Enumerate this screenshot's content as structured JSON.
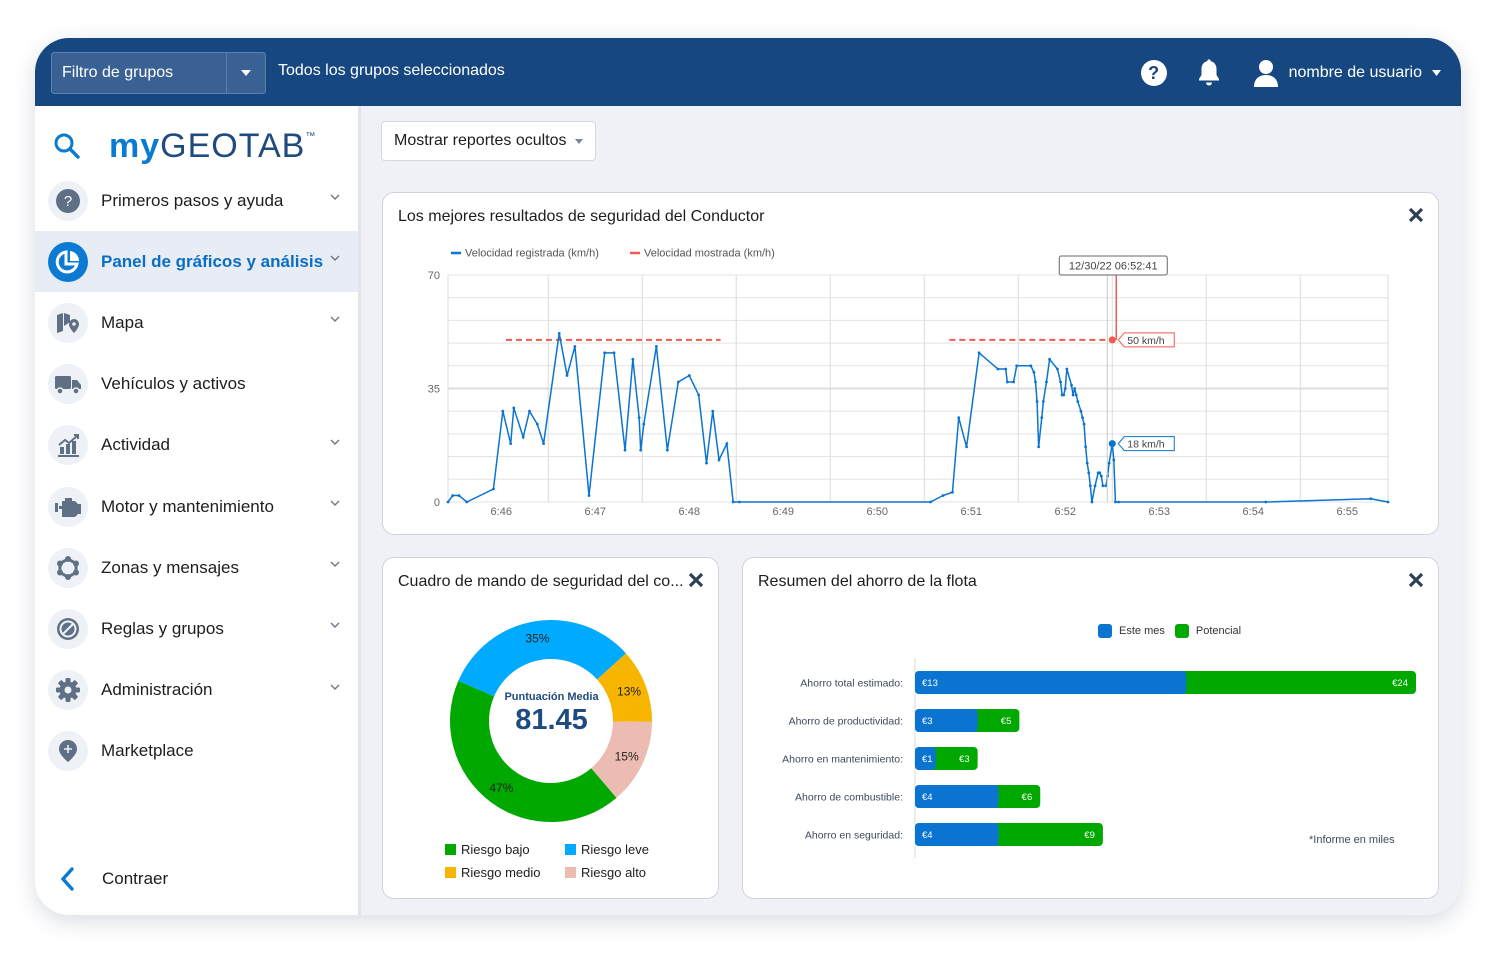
{
  "topbar": {
    "group_filter_label": "Filtro de grupos",
    "group_filter_status": "Todos los grupos seleccionados",
    "help_icon": "help-circle-icon",
    "notifications_icon": "bell-icon",
    "user_name": "nombre de usuario"
  },
  "sidebar": {
    "logo_my": "my",
    "logo_geotab": "GEOTAB",
    "logo_tm": "™",
    "items": [
      {
        "label": "Primeros pasos y ayuda",
        "icon": "help-icon",
        "expandable": true,
        "active": false
      },
      {
        "label": "Panel de gráficos y análisis",
        "icon": "pie-chart-icon",
        "expandable": true,
        "active": true
      },
      {
        "label": "Mapa",
        "icon": "map-icon",
        "expandable": true,
        "active": false
      },
      {
        "label": "Vehículos y activos",
        "icon": "truck-icon",
        "expandable": false,
        "active": false
      },
      {
        "label": "Actividad",
        "icon": "activity-chart-icon",
        "expandable": true,
        "active": false
      },
      {
        "label": "Motor y mantenimiento",
        "icon": "engine-icon",
        "expandable": true,
        "active": false
      },
      {
        "label": "Zonas y mensajes",
        "icon": "zones-icon",
        "expandable": true,
        "active": false
      },
      {
        "label": "Reglas y grupos",
        "icon": "rules-icon",
        "expandable": true,
        "active": false
      },
      {
        "label": "Administración",
        "icon": "gear-icon",
        "expandable": true,
        "active": false
      },
      {
        "label": "Marketplace",
        "icon": "marketplace-icon",
        "expandable": false,
        "active": false
      }
    ],
    "collapse_label": "Contraer"
  },
  "main": {
    "show_hidden_reports_label": "Mostrar reportes ocultos"
  },
  "colors": {
    "brand_navy": "#164780",
    "accent_blue": "#0a7ad3",
    "series_recorded": "#0b74d0",
    "series_displayed": "#f05a4f",
    "risk_low": "#00a800",
    "risk_slight": "#00aaff",
    "risk_medium": "#f8b500",
    "risk_high": "#ecbcb2",
    "bar_this_month": "#0b74d0",
    "bar_potential": "#00a800"
  },
  "chart_data": [
    {
      "type": "line",
      "title": "Los mejores resultados de seguridad del Conductor",
      "xlabel": "",
      "ylabel": "",
      "x_unit": "seconds after 6:45:00",
      "xlim": [
        26,
        626
      ],
      "ylim": [
        0,
        70
      ],
      "y_ticks": [
        0,
        35,
        70
      ],
      "y_grid_step": 7,
      "x_ticks": [
        {
          "t": 60,
          "label": "6:46"
        },
        {
          "t": 120,
          "label": "6:47"
        },
        {
          "t": 180,
          "label": "6:48"
        },
        {
          "t": 240,
          "label": "6:49"
        },
        {
          "t": 300,
          "label": "6:50"
        },
        {
          "t": 360,
          "label": "6:51"
        },
        {
          "t": 420,
          "label": "6:52"
        },
        {
          "t": 480,
          "label": "6:53"
        },
        {
          "t": 540,
          "label": "6:54"
        },
        {
          "t": 600,
          "label": "6:55"
        }
      ],
      "grid": true,
      "legend_position": "top-left",
      "series": [
        {
          "name": "Velocidad registrada (km/h)",
          "style": "solid",
          "points": [
            [
              26,
              0
            ],
            [
              29,
              2
            ],
            [
              33,
              2
            ],
            [
              38,
              0
            ],
            [
              55,
              4
            ],
            [
              61,
              28
            ],
            [
              66,
              18
            ],
            [
              68,
              29
            ],
            [
              74,
              20
            ],
            [
              78,
              28
            ],
            [
              83,
              24
            ],
            [
              87,
              18
            ],
            [
              97,
              52
            ],
            [
              102,
              39
            ],
            [
              107,
              48
            ],
            [
              116,
              2
            ],
            [
              126,
              46
            ],
            [
              132,
              46
            ],
            [
              139,
              16
            ],
            [
              144,
              44
            ],
            [
              148,
              26
            ],
            [
              149,
              16
            ],
            [
              151,
              24
            ],
            [
              159,
              48
            ],
            [
              166,
              16
            ],
            [
              173,
              37
            ],
            [
              180,
              39
            ],
            [
              186,
              33
            ],
            [
              191,
              12
            ],
            [
              195,
              28
            ],
            [
              199,
              13
            ],
            [
              204,
              18
            ],
            [
              208,
              0
            ],
            [
              212,
              0
            ],
            [
              334,
              0
            ],
            [
              342,
              2
            ],
            [
              348,
              3
            ],
            [
              352,
              26
            ],
            [
              357,
              17
            ],
            [
              365,
              46
            ],
            [
              377,
              41
            ],
            [
              382,
              41
            ],
            [
              383,
              37
            ],
            [
              387,
              37
            ],
            [
              389,
              42
            ],
            [
              398,
              42
            ],
            [
              400,
              40
            ],
            [
              401,
              37
            ],
            [
              402,
              31
            ],
            [
              403,
              17
            ],
            [
              405,
              26
            ],
            [
              406,
              31
            ],
            [
              408,
              37
            ],
            [
              410,
              44
            ],
            [
              415,
              41
            ],
            [
              417,
              37
            ],
            [
              418,
              33
            ],
            [
              419,
              33
            ],
            [
              420,
              35
            ],
            [
              421,
              41
            ],
            [
              424,
              36
            ],
            [
              425,
              33
            ],
            [
              426,
              35
            ],
            [
              427,
              33
            ],
            [
              428,
              31
            ],
            [
              430,
              28
            ],
            [
              431,
              26
            ],
            [
              432,
              24
            ],
            [
              433,
              17
            ],
            [
              434,
              12
            ],
            [
              435,
              9
            ],
            [
              436,
              5
            ],
            [
              437,
              0
            ],
            [
              439,
              5
            ],
            [
              441,
              9
            ],
            [
              442,
              9
            ],
            [
              443,
              8
            ],
            [
              444,
              5
            ],
            [
              446,
              5
            ],
            [
              447,
              8
            ],
            [
              448,
              12
            ],
            [
              450,
              18
            ],
            [
              451,
              13
            ],
            [
              452,
              0
            ],
            [
              454,
              0
            ],
            [
              548,
              0
            ],
            [
              615,
              1
            ],
            [
              626,
              0
            ]
          ]
        },
        {
          "name": "Velocidad mostrada (km/h)",
          "style": "dashed",
          "segments": [
            [
              [
                63,
                50
              ],
              [
                200,
                50
              ]
            ],
            [
              [
                346,
                50
              ],
              [
                450,
                50
              ]
            ]
          ]
        }
      ],
      "tooltip": {
        "timestamp": "12/30/22  06:52:41",
        "t": 450,
        "displayed_label": "50 km/h",
        "displayed_value": 50,
        "recorded_label": "18 km/h",
        "recorded_value": 18
      }
    },
    {
      "type": "pie",
      "title": "Cuadro de mando de seguridad del co...",
      "center_label": "Puntuación Media",
      "center_value": "81.45",
      "legend_position": "bottom",
      "slices": [
        {
          "name": "Riesgo leve",
          "value": 35,
          "label": "35%"
        },
        {
          "name": "Riesgo medio",
          "value": 13,
          "label": "13%"
        },
        {
          "name": "Riesgo alto",
          "value": 15,
          "label": "15%"
        },
        {
          "name": "Riesgo bajo",
          "value": 47,
          "label": "47%"
        }
      ],
      "legend": [
        "Riesgo bajo",
        "Riesgo leve",
        "Riesgo medio",
        "Riesgo alto"
      ]
    },
    {
      "type": "bar",
      "orientation": "horizontal",
      "title": "Resumen del ahorro de la flota",
      "legend_position": "top",
      "note": "*Informe en miles",
      "categories": [
        "Ahorro total estimado:",
        "Ahorro de productividad:",
        "Ahorro en mantenimiento:",
        "Ahorro de combustible:",
        "Ahorro en seguridad:"
      ],
      "series": [
        {
          "name": "Este mes",
          "values": [
            13,
            3,
            1,
            4,
            4
          ],
          "labels": [
            "€13",
            "€3",
            "€1",
            "€4",
            "€4"
          ]
        },
        {
          "name": "Potencial",
          "values": [
            24,
            5,
            3,
            6,
            9
          ],
          "labels": [
            "€24",
            "€5",
            "€3",
            "€6",
            "€9"
          ]
        }
      ],
      "xlim": [
        0,
        24
      ]
    }
  ]
}
